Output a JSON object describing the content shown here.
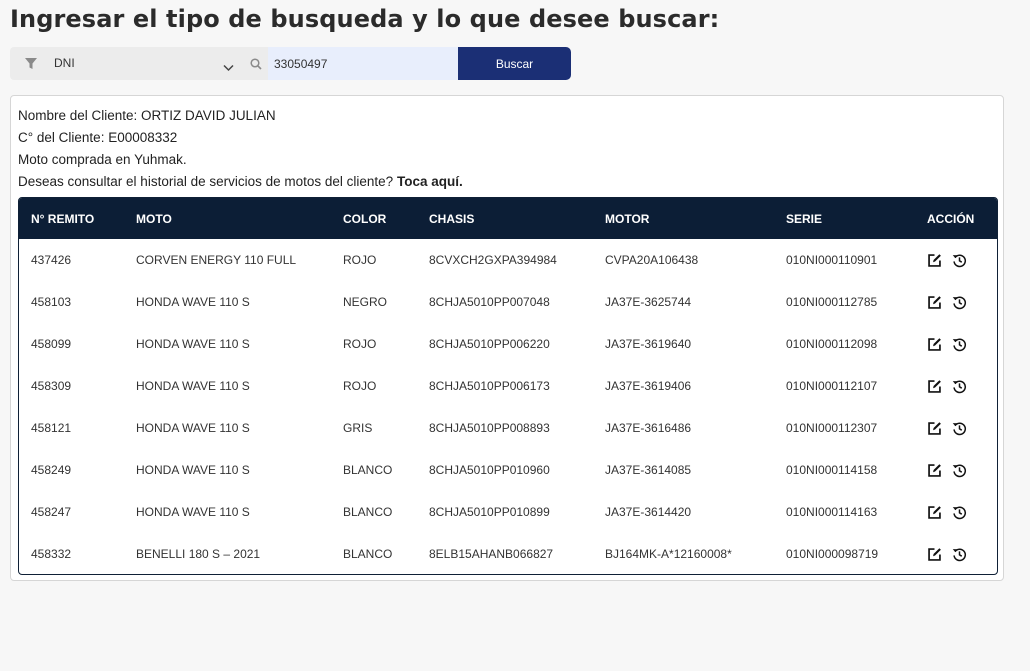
{
  "page_title": "Ingresar el tipo de busqueda y lo que desee buscar:",
  "search": {
    "filter_selected": "DNI",
    "query_value": "33050497",
    "button_label": "Buscar"
  },
  "client": {
    "name_line": "Nombre del Cliente: ORTIZ DAVID JULIAN",
    "code_line": "C° del Cliente: E00008332",
    "purchase_line": "Moto comprada en Yuhmak.",
    "history_prompt": "Deseas consultar el historial de servicios de motos del cliente?",
    "history_link": "Toca aquí."
  },
  "table": {
    "headers": [
      "N° REMITO",
      "MOTO",
      "COLOR",
      "CHASIS",
      "MOTOR",
      "SERIE",
      "ACCIÓN"
    ],
    "rows": [
      [
        "437426",
        "CORVEN ENERGY 110 FULL",
        "ROJO",
        "8CVXCH2GXPA394984",
        "CVPA20A106438",
        "010NI000110901"
      ],
      [
        "458103",
        "HONDA WAVE 110 S",
        "NEGRO",
        "8CHJA5010PP007048",
        "JA37E-3625744",
        "010NI000112785"
      ],
      [
        "458099",
        "HONDA WAVE 110 S",
        "ROJO",
        "8CHJA5010PP006220",
        "JA37E-3619640",
        "010NI000112098"
      ],
      [
        "458309",
        "HONDA WAVE 110 S",
        "ROJO",
        "8CHJA5010PP006173",
        "JA37E-3619406",
        "010NI000112107"
      ],
      [
        "458121",
        "HONDA WAVE 110 S",
        "GRIS",
        "8CHJA5010PP008893",
        "JA37E-3616486",
        "010NI000112307"
      ],
      [
        "458249",
        "HONDA WAVE 110 S",
        "BLANCO",
        "8CHJA5010PP010960",
        "JA37E-3614085",
        "010NI000114158"
      ],
      [
        "458247",
        "HONDA WAVE 110 S",
        "BLANCO",
        "8CHJA5010PP010899",
        "JA37E-3614420",
        "010NI000114163"
      ],
      [
        "458332",
        "BENELLI 180 S – 2021",
        "BLANCO",
        "8ELB15AHANB066827",
        "BJ164MK-A*12160008*",
        "010NI000098719"
      ]
    ],
    "action_icons": [
      "edit-icon",
      "history-icon"
    ]
  },
  "colors": {
    "header_bg": "#0c1e36",
    "button_bg": "#1b2f75",
    "input_bg": "#e8eefc"
  }
}
